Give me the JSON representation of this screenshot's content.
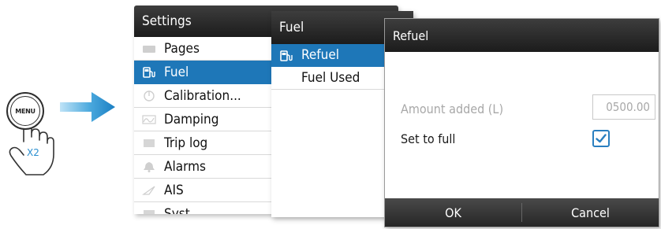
{
  "menu_button": {
    "label": "MENU",
    "press_count": "X2"
  },
  "settings": {
    "title": "Settings",
    "items": [
      {
        "label": "Pages",
        "icon": "pages-icon",
        "selected": false
      },
      {
        "label": "Fuel",
        "icon": "fuel-pump-icon",
        "selected": true
      },
      {
        "label": "Calibration...",
        "icon": "calibration-icon",
        "selected": false
      },
      {
        "label": "Damping",
        "icon": "damping-icon",
        "selected": false
      },
      {
        "label": "Trip log",
        "icon": "trip-log-icon",
        "selected": false
      },
      {
        "label": "Alarms",
        "icon": "bell-icon",
        "selected": false
      },
      {
        "label": "AIS",
        "icon": "ais-icon",
        "selected": false
      },
      {
        "label": "Syst...",
        "icon": "system-icon",
        "selected": false
      }
    ]
  },
  "fuel": {
    "title": "Fuel",
    "items": [
      {
        "label": "Refuel",
        "icon": "fuel-pump-icon",
        "selected": true
      },
      {
        "label": "Fuel Used",
        "selected": false
      }
    ]
  },
  "refuel": {
    "title": "Refuel",
    "amount_label": "Amount added  (L)",
    "amount_value": "0500.00",
    "set_full_label": "Set to full",
    "set_full_checked": true,
    "ok_label": "OK",
    "cancel_label": "Cancel"
  },
  "colors": {
    "selection": "#1e77b8",
    "accent": "#2a8fd0",
    "titlebar": "#2b2b2b"
  }
}
